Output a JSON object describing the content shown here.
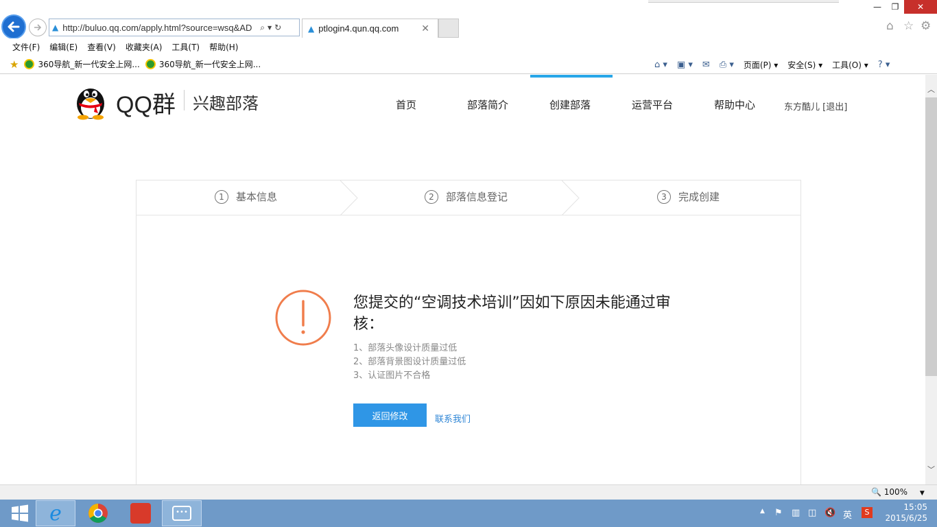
{
  "browser": {
    "url": "http://buluo.qq.com/apply.html?source=wsq&AD",
    "tab_title": "ptlogin4.qun.qq.com",
    "menu": [
      "文件(F)",
      "编辑(E)",
      "查看(V)",
      "收藏夹(A)",
      "工具(T)",
      "帮助(H)"
    ],
    "favorites": [
      "360导航_新一代安全上网...",
      "360导航_新一代安全上网..."
    ],
    "commands": {
      "page": "页面(P)",
      "safety": "安全(S)",
      "tools": "工具(O)"
    },
    "zoom": "100%"
  },
  "site": {
    "logo_text": "QQ群",
    "logo_sub": "兴趣部落",
    "nav": [
      "首页",
      "部落简介",
      "创建部落",
      "运营平台",
      "帮助中心"
    ],
    "active_nav_index": 2,
    "user": "东方酷儿",
    "logout": "[退出]"
  },
  "steps": [
    {
      "num": "1",
      "label": "基本信息"
    },
    {
      "num": "2",
      "label": "部落信息登记"
    },
    {
      "num": "3",
      "label": "完成创建"
    }
  ],
  "result": {
    "title": "您提交的“空调技术培训”因如下原因未能通过审核：",
    "reasons": [
      "1、部落头像设计质量过低",
      "2、部落背景图设计质量过低",
      "3、认证图片不合格"
    ],
    "back_button": "返回修改",
    "contact_link": "联系我们",
    "accent_color": "#f07d4c",
    "button_color": "#2f96e6"
  },
  "taskbar": {
    "time": "15:05",
    "date": "2015/6/25",
    "ime": "英"
  }
}
